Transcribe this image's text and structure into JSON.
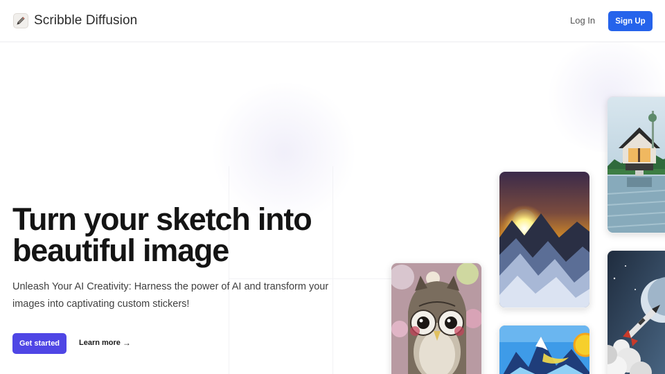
{
  "header": {
    "brand_name": "Scribble Diffusion",
    "logo_icon": "pencil-icon",
    "login_label": "Log In",
    "signup_label": "Sign Up",
    "accent_color": "#2563eb"
  },
  "hero": {
    "title_line1": "Turn your sketch into",
    "title_line2": "beautiful image",
    "subtitle": "Unleash Your AI Creativity: Harness the power of AI and transform your images into captivating custom stickers!",
    "cta_label": "Get started",
    "cta_color": "#4f46e5",
    "learn_label": "Learn more",
    "learn_icon": "arrow-right-icon"
  },
  "gallery": {
    "images": [
      "owl-image",
      "mountain-sunset-image",
      "mountain-sun-illustration",
      "lake-house-image",
      "rocket-image"
    ]
  }
}
